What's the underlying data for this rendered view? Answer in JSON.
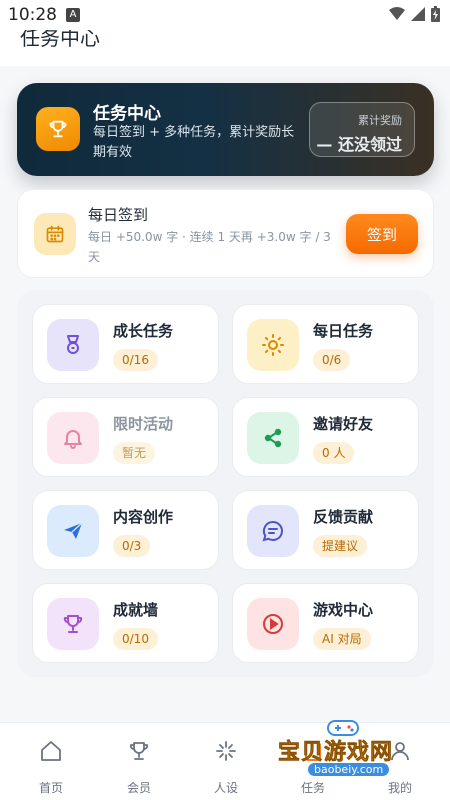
{
  "status_bar": {
    "time": "10:28",
    "notification_glyph": "A"
  },
  "header": {
    "title": "任务中心"
  },
  "hero": {
    "title": "任务中心",
    "subtitle": "每日签到 + 多种任务，累计奖励长期有效",
    "reward_label": "累计奖励",
    "reward_value": "— 还没领过"
  },
  "checkin": {
    "title": "每日签到",
    "description": "每日 +50.0w 字 · 连续 1 天再 +3.0w 字 / 3 天",
    "button_label": "签到"
  },
  "tasks": [
    {
      "title": "成长任务",
      "badge": "0/16",
      "icon": "medal-icon"
    },
    {
      "title": "每日任务",
      "badge": "0/6",
      "icon": "sun-icon"
    },
    {
      "title": "限时活动",
      "badge": "暂无",
      "icon": "bell-icon"
    },
    {
      "title": "邀请好友",
      "badge": "0 人",
      "icon": "share-icon"
    },
    {
      "title": "内容创作",
      "badge": "0/3",
      "icon": "paper-plane-icon"
    },
    {
      "title": "反馈贡献",
      "badge": "提建议",
      "icon": "chat-bubble-icon"
    },
    {
      "title": "成就墙",
      "badge": "0/10",
      "icon": "trophy-icon"
    },
    {
      "title": "游戏中心",
      "badge": "AI 对局",
      "icon": "play-icon"
    }
  ],
  "bottom_nav": [
    {
      "label": "首页",
      "icon": "home-icon"
    },
    {
      "label": "会员",
      "icon": "trophy-icon"
    },
    {
      "label": "人设",
      "icon": "sparkle-icon"
    },
    {
      "label": "任务",
      "icon": "task-icon"
    },
    {
      "label": "我的",
      "icon": "profile-icon"
    }
  ],
  "watermark": {
    "text": "宝贝游戏网",
    "url": "baobeiy.com"
  },
  "colors": {
    "accent_orange": "#f46a00",
    "badge_orange_bg": "#fdf0d6",
    "badge_orange_text": "#b86a00"
  }
}
